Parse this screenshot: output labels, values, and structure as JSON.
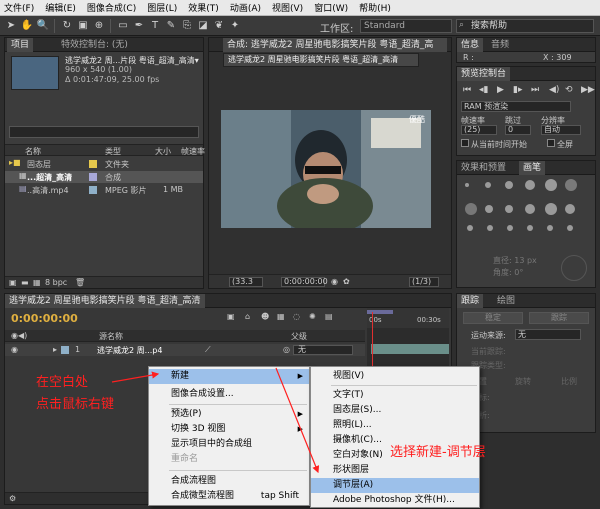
{
  "menubar": [
    "文件(F)",
    "编辑(E)",
    "图像合成(C)",
    "图层(L)",
    "效果(T)",
    "动画(A)",
    "视图(V)",
    "窗口(W)",
    "帮助(H)"
  ],
  "toolbar": {
    "workspace_label": "工作区:",
    "workspace_value": "Standard",
    "search_placeholder": "搜索帮助"
  },
  "project": {
    "tabs": [
      "项目",
      "特效控制台: (无)"
    ],
    "item_name": "逃学威龙2 周...片段 粤语_超清_高清▾",
    "item_meta_1": "960 x 540 (1.00)",
    "item_meta_2": "Δ 0:01:47:09, 25.00 fps",
    "columns": [
      "名称",
      "类型",
      "大小",
      "帧速率"
    ],
    "rows": [
      {
        "name": "固态层",
        "type": "文件夹",
        "size": "",
        "swatch": "#e6c84c"
      },
      {
        "name": "...超清_高清",
        "type": "合成",
        "size": "",
        "swatch": "#a8a8d8"
      },
      {
        "name": "..高清.mp4",
        "type": "MPEG 影片",
        "size": "1 MB",
        "swatch": "#8fb0c8"
      }
    ],
    "bpc": "8 bpc"
  },
  "composition": {
    "tab": "合成: 逃学威龙2 周星驰电影搞笑片段 粤语_超清_高",
    "subtab": "逃学威龙2 周星驰电影搞笑片段 粤语_超清_高清",
    "watermark": "優酷",
    "zoom": "(33.3",
    "time": "0:00:00:00",
    "res": "(1/3)"
  },
  "info": {
    "tabs": [
      "信息",
      "音频"
    ],
    "r_label": "R :",
    "x_label": "X : 309"
  },
  "preview": {
    "tab": "预览控制台",
    "ram": "RAM 预渲染",
    "labels": [
      "帧速率",
      "跳过",
      "分辨率"
    ],
    "values": [
      "(25)",
      "0",
      "自动"
    ],
    "check1": "从当前时间开始",
    "check2": "全屏"
  },
  "brushes": {
    "tabs": [
      "效果和预置",
      "画笔"
    ],
    "diameter": "直径: 13 px",
    "angle": "角度: 0°"
  },
  "timeline": {
    "tab": "逃学威龙2 周星驰电影搞笑片段 粤语_超清_高清",
    "timecode": "0:00:00:00",
    "col_name": "源名称",
    "col_parent": "父级",
    "layer_num": "1",
    "layer_name": "逃学威龙2 周...p4",
    "layer_parent": "无",
    "ruler_start": "00s",
    "ruler_end": "00:30s"
  },
  "tracker": {
    "tabs": [
      "跟踪",
      "绘图"
    ],
    "buttons": [
      "稳定",
      "跟踪"
    ],
    "motion_source_label": "运动来源:",
    "motion_source_value": "无",
    "current_track_label": "当前跟踪:",
    "track_type_label": "跟踪类型:",
    "options": [
      "位置",
      "旋转",
      "比例"
    ],
    "target_label": "目标:",
    "analyze_label": "分析:"
  },
  "context_menu": {
    "items": [
      {
        "label": "新建",
        "submenu": true,
        "highlight": true
      },
      {
        "label": "图像合成设置...",
        "separator_after": true
      },
      {
        "label": "预选(P)",
        "submenu": true
      },
      {
        "label": "切换 3D 视图",
        "submenu": true
      },
      {
        "label": "显示项目中的合成组"
      },
      {
        "label": "重命名",
        "disabled": true,
        "separator_after": true
      },
      {
        "label": "合成流程图"
      },
      {
        "label": "合成微型流程图",
        "shortcut": "tap Shift"
      }
    ]
  },
  "submenu": {
    "items": [
      {
        "label": "视图(V)",
        "separator_after": true
      },
      {
        "label": "文字(T)"
      },
      {
        "label": "固态层(S)..."
      },
      {
        "label": "照明(L)..."
      },
      {
        "label": "摄像机(C)..."
      },
      {
        "label": "空白对象(N)"
      },
      {
        "label": "形状图层"
      },
      {
        "label": "调节层(A)",
        "highlight": true
      },
      {
        "label": "Adobe Photoshop 文件(H)..."
      }
    ]
  },
  "annotations": {
    "left_line1": "在空白处",
    "left_line2": "点击鼠标右键",
    "right": "选择新建-调节层",
    "color": "#ff2020"
  }
}
